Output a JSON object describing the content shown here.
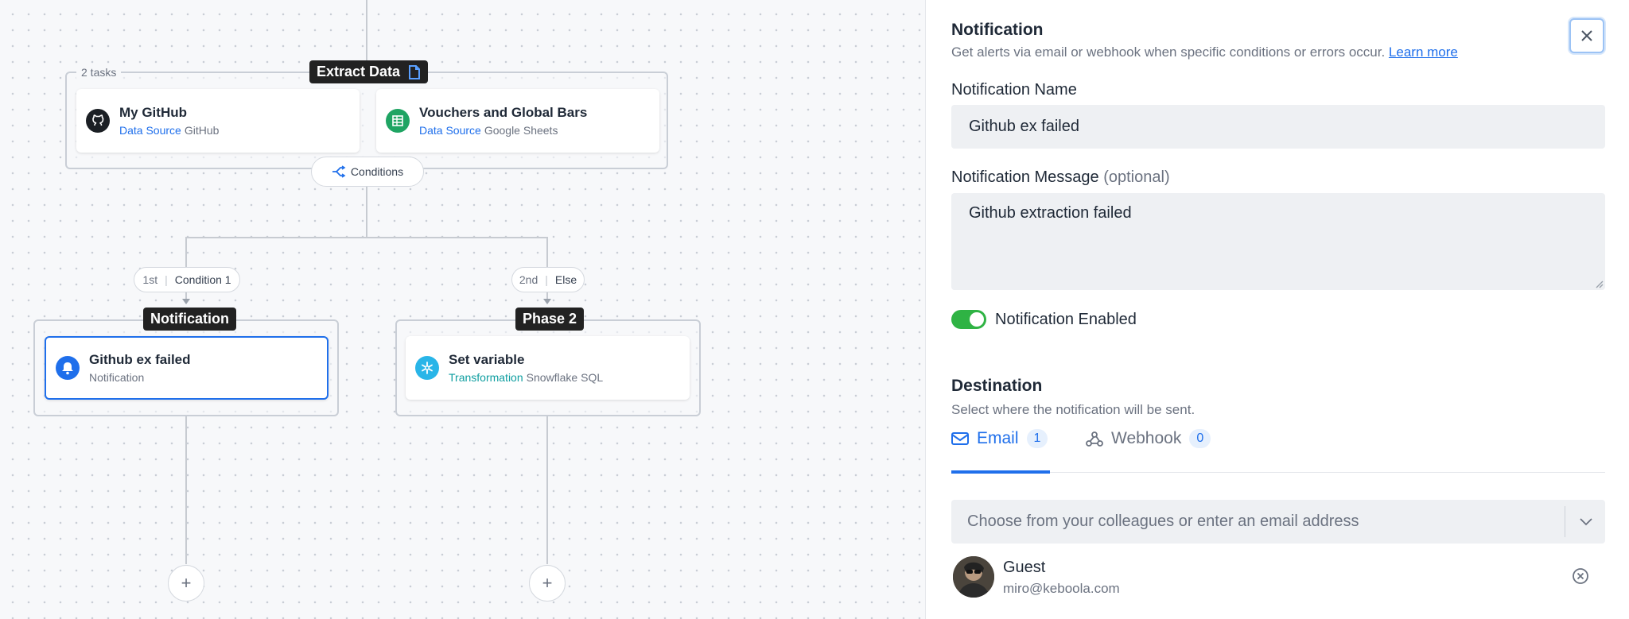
{
  "canvas": {
    "phase1": {
      "label": "Extract Data",
      "tasks_count": "2 tasks",
      "tasks": [
        {
          "title": "My GitHub",
          "type": "Data Source",
          "component": "GitHub",
          "icon": "github-icon"
        },
        {
          "title": "Vouchers and Global Bars",
          "type": "Data Source",
          "component": "Google Sheets",
          "icon": "google-sheets-icon"
        }
      ]
    },
    "conditions_label": "Conditions",
    "branch1": {
      "ordinal": "1st",
      "name": "Condition 1"
    },
    "branch2": {
      "ordinal": "2nd",
      "name": "Else"
    },
    "phase2": {
      "label": "Notification",
      "task": {
        "title": "Github ex failed",
        "subtitle": "Notification",
        "icon": "bell-icon"
      }
    },
    "phase3": {
      "label": "Phase 2",
      "task": {
        "title": "Set variable",
        "type": "Transformation",
        "component": "Snowflake SQL",
        "icon": "snowflake-icon"
      }
    },
    "add_symbol": "+"
  },
  "panel": {
    "title": "Notification",
    "description": "Get alerts via email or webhook when specific conditions or errors occur.",
    "learn_more": "Learn more",
    "name_label": "Notification Name",
    "name_value": "Github ex failed",
    "message_label": "Notification Message",
    "message_optional": "(optional)",
    "message_value": "Github extraction failed",
    "enabled_label": "Notification Enabled",
    "destination_title": "Destination",
    "destination_desc": "Select where the notification will be sent.",
    "tabs": [
      {
        "label": "Email",
        "count": "1",
        "icon": "mail-icon",
        "active": true
      },
      {
        "label": "Webhook",
        "count": "0",
        "icon": "webhook-icon",
        "active": false
      }
    ],
    "recipient_placeholder": "Choose from your colleagues or enter an email address",
    "recipient": {
      "name": "Guest",
      "email": "miro@keboola.com"
    }
  },
  "colors": {
    "accent": "#1f6feb",
    "toggle_on": "#2fb344",
    "teal": "#0e9ea0"
  }
}
